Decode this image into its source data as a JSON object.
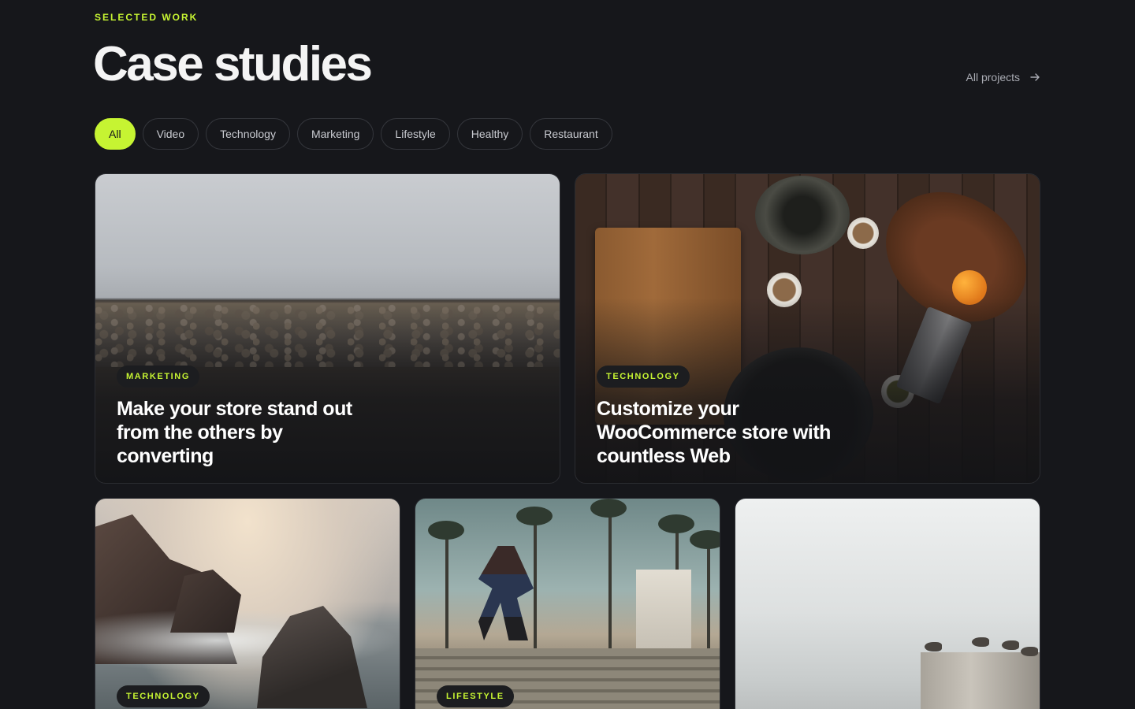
{
  "header": {
    "eyebrow": "SELECTED WORK",
    "title": "Case studies",
    "all_projects_label": "All projects"
  },
  "filters": [
    {
      "label": "All",
      "active": true
    },
    {
      "label": "Video",
      "active": false
    },
    {
      "label": "Technology",
      "active": false
    },
    {
      "label": "Marketing",
      "active": false
    },
    {
      "label": "Lifestyle",
      "active": false
    },
    {
      "label": "Healthy",
      "active": false
    },
    {
      "label": "Restaurant",
      "active": false
    }
  ],
  "cards": [
    {
      "tag": "MARKETING",
      "title": "Make your store stand out from the others by converting",
      "image": "stone sea wall over water"
    },
    {
      "tag": "TECHNOLOGY",
      "title": "Customize your WooCommerce store with countless Web",
      "image": "kitchen spices on wooden table"
    },
    {
      "tag": "TECHNOLOGY",
      "title": "",
      "image": "rocks and crashing waves"
    },
    {
      "tag": "LIFESTYLE",
      "title": "",
      "image": "skateboarder in park with palm trees"
    },
    {
      "tag": "",
      "title": "",
      "image": "seagulls on pier under cloudy sky"
    }
  ],
  "colors": {
    "background": "#16171b",
    "accent": "#c6f432",
    "pill_border": "#34363c",
    "muted_text": "#a9abb3"
  },
  "icons": {
    "all_projects": "arrow-right-icon"
  }
}
